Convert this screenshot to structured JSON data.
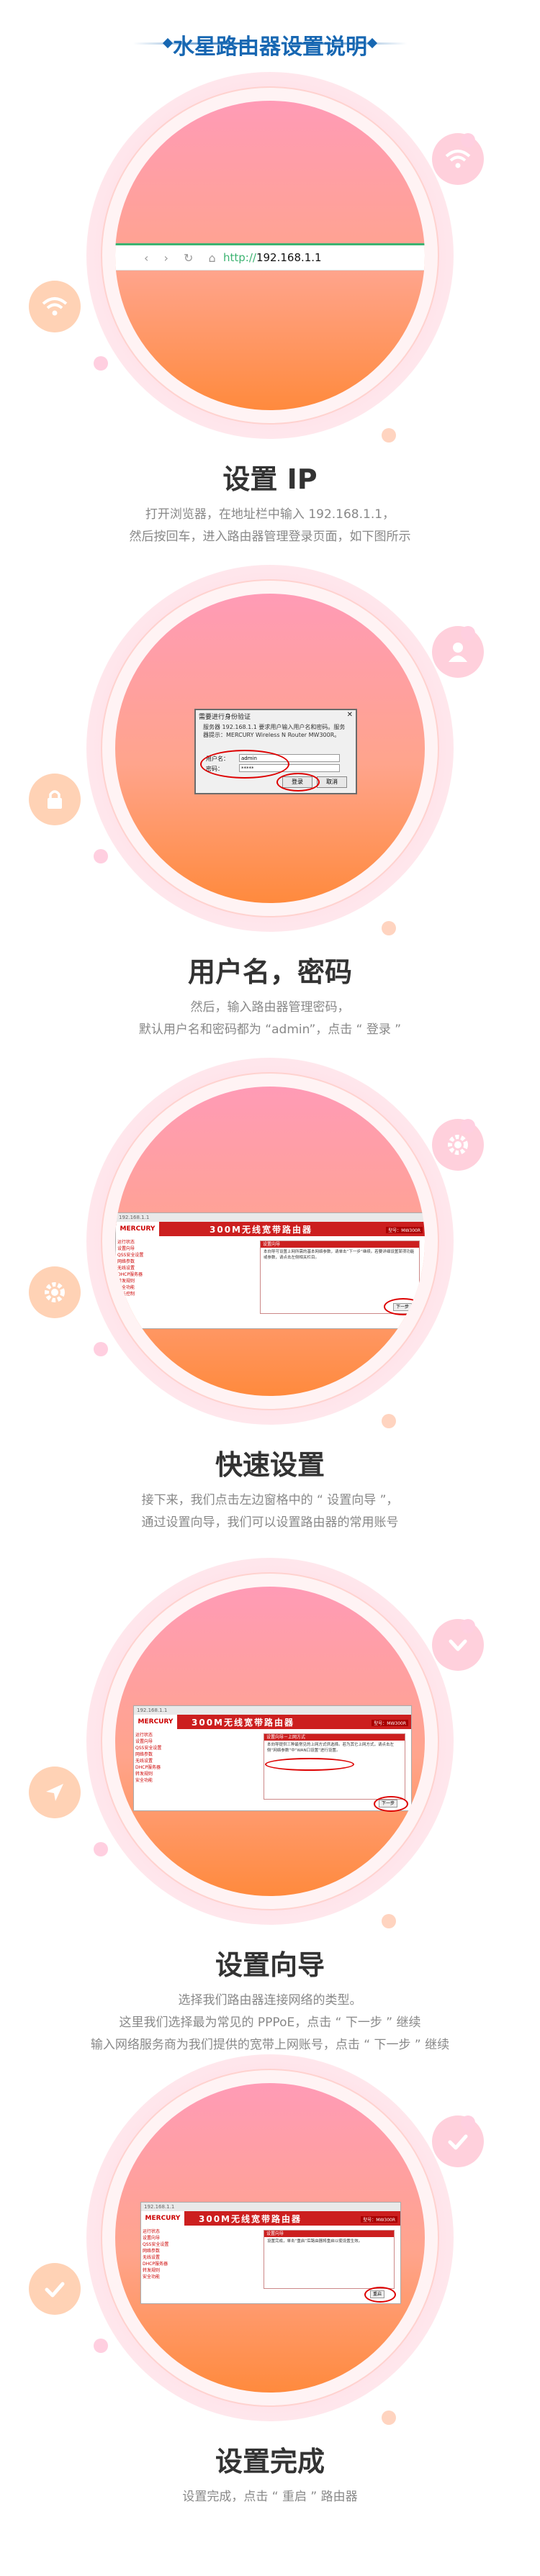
{
  "page_title": "水星路由器设置说明",
  "accent_color": "#1767b2",
  "sections": [
    {
      "icon": "wifi-icon",
      "title": "设置 IP",
      "desc": [
        "打开浏览器，在地址栏中输入 192.168.1.1，",
        "然后按回车，进入路由器管理登录页面，如下图所示"
      ],
      "browser": {
        "scheme": "http://",
        "url": "192.168.1.1"
      }
    },
    {
      "icon": "user-icon",
      "side_icon": "lock-icon",
      "title": "用户名，密码",
      "desc": [
        "然后，输入路由器管理密码，",
        "默认用户名和密码都为 “admin”，点击 “ 登录 ”"
      ],
      "dialog": {
        "title": "需要进行身份验证",
        "message": "服务器 192.168.1.1 要求用户输入用户名和密码。服务器提示：MERCURY Wireless N Router MW300R。",
        "user_label": "用户名：",
        "user_value": "admin",
        "pass_label": "密码：",
        "pass_value": "*****",
        "login": "登录",
        "cancel": "取消"
      }
    },
    {
      "icon": "gear-icon",
      "title": "快速设置",
      "desc": [
        "接下来，我们点击左边窗格中的 “ 设置向导 ”，",
        "通过设置向导，我们可以设置路由器的常用账号"
      ],
      "window": {
        "logo": "MERCURY",
        "banner": "300M无线宽带路由器",
        "model": "型号：MW300R",
        "tab_url": "192.168.1.1",
        "panel_title": "设置向导",
        "panel_text": "本向导可设置上网所需的基本网络参数，请单击“下一步”继续。若要详细设置某项功能或参数，请点击左侧相关栏目。",
        "next": "下一步"
      }
    },
    {
      "icon": "chevron-down-icon",
      "side_icon": "navigation-icon",
      "title": "设置向导",
      "desc": [
        "选择我们路由器连接网络的类型。",
        "这里我们选择最为常见的 PPPoE，点击 “ 下一步 ” 继续",
        "输入网络服务商为我们提供的宽带上网账号，点击 “ 下一步 ” 继续"
      ],
      "window": {
        "logo": "MERCURY",
        "banner": "300M无线宽带路由器",
        "model": "型号：MW300R",
        "tab_url": "192.168.1.1",
        "panel_title": "设置向导－上网方式",
        "panel_text": "本向导提供三种最常见的上网方式供选择。若为其它上网方式，请点击左侧“网络参数”中“WAN口设置”进行设置。",
        "next": "下一步"
      }
    },
    {
      "icon": "check-icon",
      "side_icon": "check-icon",
      "title": "设置完成",
      "desc": [
        "设置完成，点击 “ 重启 ” 路由器"
      ],
      "window": {
        "logo": "MERCURY",
        "banner": "300M无线宽带路由器",
        "model": "型号：MW300R",
        "tab_url": "192.168.1.1",
        "panel_title": "设置向导",
        "panel_text": "设置完成，单击“重启”后路由器将重启以使设置生效。",
        "next": "重启"
      }
    }
  ],
  "menu_items": [
    "运行状态",
    "设置向导",
    "QSS安全设置",
    "网络参数",
    "无线设置",
    "DHCP服务器",
    "转发规则",
    "安全功能",
    "家长控制"
  ]
}
